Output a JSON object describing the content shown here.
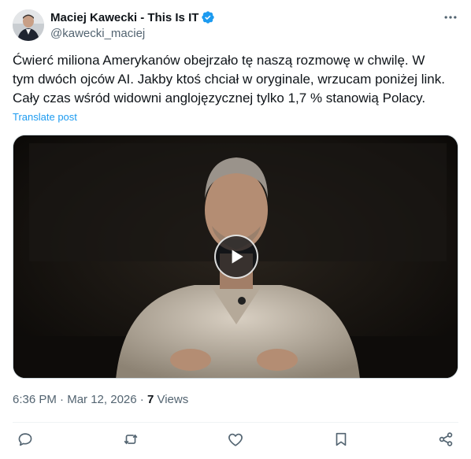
{
  "author": {
    "display_name": "Maciej Kawecki - This Is IT",
    "handle": "@kawecki_maciej",
    "verified": true,
    "verified_color": "#1d9bf0"
  },
  "post": {
    "text_lines": [
      "Ćwierć miliona Amerykanów obejrzało tę naszą rozmowę w chwilę. W",
      "tym dwóch ojców AI. Jakby ktoś chciał w oryginale, wrzucam poniżej link.",
      "Cały czas wśród widowni anglojęzycznej tylko 1,7 % stanowią Polacy."
    ],
    "translate_label": "Translate post",
    "time": "6:36 PM",
    "date": "Mar 12, 2026",
    "views_count": "7",
    "views_label": "Views"
  },
  "media": {
    "type": "video",
    "play_icon": "play-icon"
  },
  "actions": [
    {
      "name": "reply-button",
      "icon": "reply-icon"
    },
    {
      "name": "repost-button",
      "icon": "repost-icon"
    },
    {
      "name": "like-button",
      "icon": "heart-icon"
    },
    {
      "name": "bookmark-button",
      "icon": "bookmark-icon"
    },
    {
      "name": "share-button",
      "icon": "share-icon"
    }
  ],
  "colors": {
    "text": "#0f1419",
    "secondary": "#536471",
    "link": "#1d9bf0",
    "action_icon": "#536471"
  }
}
